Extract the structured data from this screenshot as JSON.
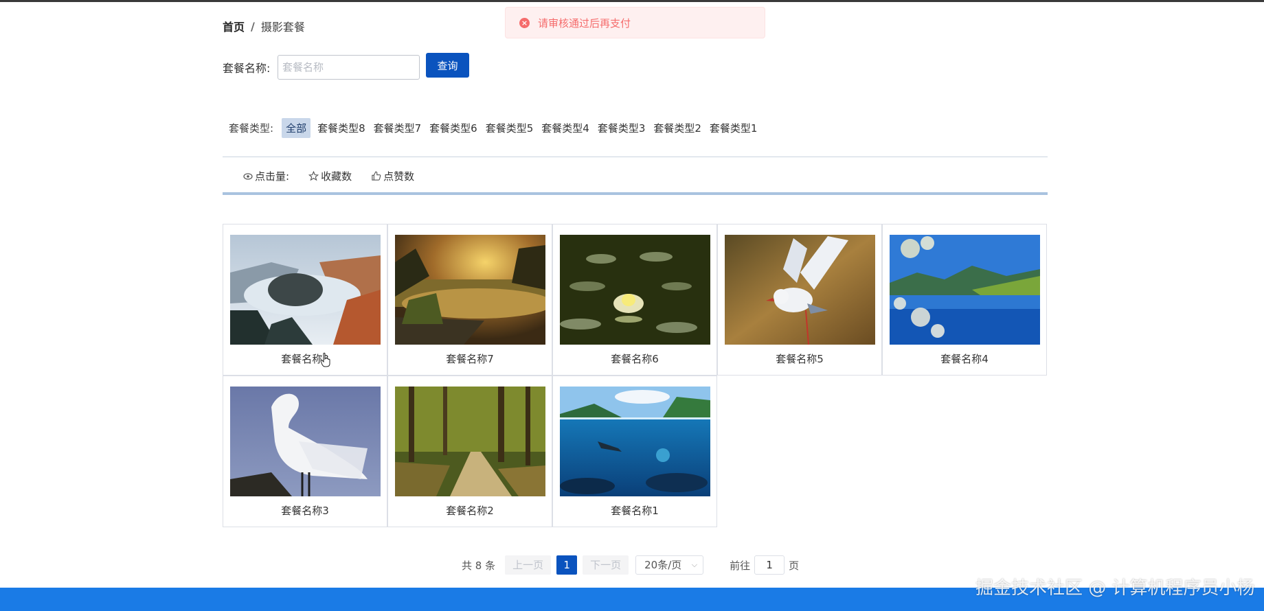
{
  "breadcrumb": {
    "home": "首页",
    "separator": "/",
    "current": "摄影套餐"
  },
  "toast": {
    "message": "请审核通过后再支付",
    "icon": "error-circle-icon",
    "color": "#f56c6c"
  },
  "search": {
    "label": "套餐名称:",
    "placeholder": "套餐名称",
    "value": "",
    "button_label": "查询"
  },
  "type_filter": {
    "label": "套餐类型:",
    "items": [
      {
        "label": "全部",
        "active": true
      },
      {
        "label": "套餐类型8",
        "active": false
      },
      {
        "label": "套餐类型7",
        "active": false
      },
      {
        "label": "套餐类型6",
        "active": false
      },
      {
        "label": "套餐类型5",
        "active": false
      },
      {
        "label": "套餐类型4",
        "active": false
      },
      {
        "label": "套餐类型3",
        "active": false
      },
      {
        "label": "套餐类型2",
        "active": false
      },
      {
        "label": "套餐类型1",
        "active": false
      }
    ]
  },
  "sort": {
    "items": [
      {
        "label": "点击量:",
        "icon": "eye-icon"
      },
      {
        "label": "收藏数",
        "icon": "star-icon"
      },
      {
        "label": "点赞数",
        "icon": "thumbs-up-icon"
      }
    ]
  },
  "packages": [
    {
      "title": "套餐名称8",
      "image": "river-bend-landscape"
    },
    {
      "title": "套餐名称7",
      "image": "sunset-pond"
    },
    {
      "title": "套餐名称6",
      "image": "water-lily"
    },
    {
      "title": "套餐名称5",
      "image": "flying-gull"
    },
    {
      "title": "套餐名称4",
      "image": "blue-lake-blossoms"
    },
    {
      "title": "套餐名称3",
      "image": "white-egret"
    },
    {
      "title": "套餐名称2",
      "image": "forest-path"
    },
    {
      "title": "套餐名称1",
      "image": "tropical-diver"
    }
  ],
  "pagination": {
    "total_text": "共 8 条",
    "prev_label": "上一页",
    "current_page": "1",
    "next_label": "下一页",
    "page_size": "20条/页",
    "goto_label": "前往",
    "goto_value": "1",
    "page_suffix": "页"
  },
  "watermark": "掘金技术社区 @ 计算机程序员小杨",
  "colors": {
    "primary": "#0a53be",
    "active_tag": "#c9d7ea",
    "footer": "#1a7be6"
  }
}
